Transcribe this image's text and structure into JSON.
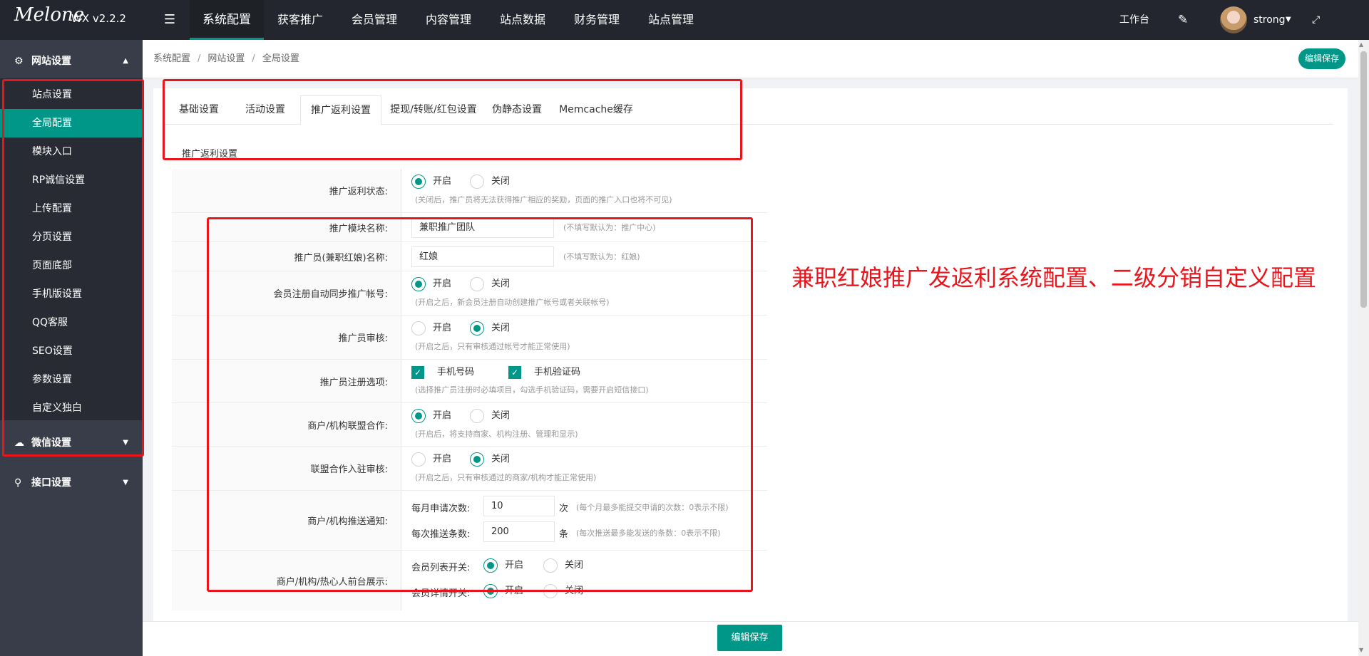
{
  "app": {
    "logo_text": "Melone",
    "version": "WX v2.2.2"
  },
  "topnav": [
    {
      "label": "系统配置"
    },
    {
      "label": "获客推广"
    },
    {
      "label": "会员管理"
    },
    {
      "label": "内容管理"
    },
    {
      "label": "站点数据"
    },
    {
      "label": "财务管理"
    },
    {
      "label": "站点管理"
    }
  ],
  "topright": {
    "workbench": "工作台",
    "username": "strong"
  },
  "sidebar": {
    "groups": [
      {
        "label": "网站设置",
        "icon": "gear-icon"
      },
      {
        "label": "微信设置",
        "icon": "wechat-icon"
      },
      {
        "label": "接口设置",
        "icon": "link-icon"
      }
    ],
    "items": [
      {
        "label": "站点设置"
      },
      {
        "label": "全局配置"
      },
      {
        "label": "模块入口"
      },
      {
        "label": "RP诚信设置"
      },
      {
        "label": "上传配置"
      },
      {
        "label": "分页设置"
      },
      {
        "label": "页面底部"
      },
      {
        "label": "手机版设置"
      },
      {
        "label": "QQ客服"
      },
      {
        "label": "SEO设置"
      },
      {
        "label": "参数设置"
      },
      {
        "label": "自定义独白"
      }
    ]
  },
  "breadcrumb": [
    "系统配置",
    "网站设置",
    "全局设置"
  ],
  "buttons": {
    "save_top": "编辑保存",
    "save_bottom": "编辑保存"
  },
  "tabs": [
    {
      "label": "基础设置"
    },
    {
      "label": "活动设置"
    },
    {
      "label": "推广返利设置"
    },
    {
      "label": "提现/转账/红包设置"
    },
    {
      "label": "伪静态设置"
    },
    {
      "label": "Memcache缓存"
    }
  ],
  "section_title": "推广返利设置",
  "radio_on": "开启",
  "radio_off": "关闭",
  "form": {
    "status": {
      "label": "推广返利状态:",
      "value": "on",
      "hint": "(关闭后，推广员将无法获得推广相应的奖励，页面的推广入口也将不可见)"
    },
    "module_name": {
      "label": "推广模块名称:",
      "value": "兼职推广团队",
      "hint": "(不填写默认为：推广中心)"
    },
    "promoter_name": {
      "label": "推广员(兼职红娘)名称:",
      "value": "红娘",
      "hint": "(不填写默认为：红娘)"
    },
    "auto_sync": {
      "label": "会员注册自动同步推广帐号:",
      "value": "on",
      "hint": "(开启之后，新会员注册自动创建推广帐号或者关联帐号)"
    },
    "review": {
      "label": "推广员审核:",
      "value": "off",
      "hint": "(开启之后，只有审核通过帐号才能正常使用)"
    },
    "reg_options": {
      "label": "推广员注册选项:",
      "opt1": "手机号码",
      "opt2": "手机验证码",
      "hint": "(选择推广员注册时必填项目，勾选手机验证码，需要开启短信接口)"
    },
    "alliance": {
      "label": "商户/机构联盟合作:",
      "value": "on",
      "hint": "(开启后，将支持商家、机构注册、管理和显示)"
    },
    "alliance_review": {
      "label": "联盟合作入驻审核:",
      "value": "off",
      "hint": "(开启之后，只有审核通过的商家/机构才能正常使用)"
    },
    "push_notice": {
      "label": "商户/机构推送通知:",
      "monthly_label": "每月申请次数:",
      "monthly_value": "10",
      "monthly_unit": "次",
      "monthly_hint": "(每个月最多能提交申请的次数：0表示不限)",
      "per_label": "每次推送条数:",
      "per_value": "200",
      "per_unit": "条",
      "per_hint": "(每次推送最多能发送的条数：0表示不限)"
    },
    "frontend": {
      "label": "商户/机构/热心人前台展示:",
      "list_label": "会员列表开关:",
      "detail_label": "会员详情开关:"
    }
  },
  "annotation": "兼职红娘推广发返利系统配置、二级分销自定义配置",
  "colors": {
    "accent": "#009688",
    "annotation": "#e8161c",
    "topbar": "#23262e",
    "sidebar": "#393d49"
  }
}
